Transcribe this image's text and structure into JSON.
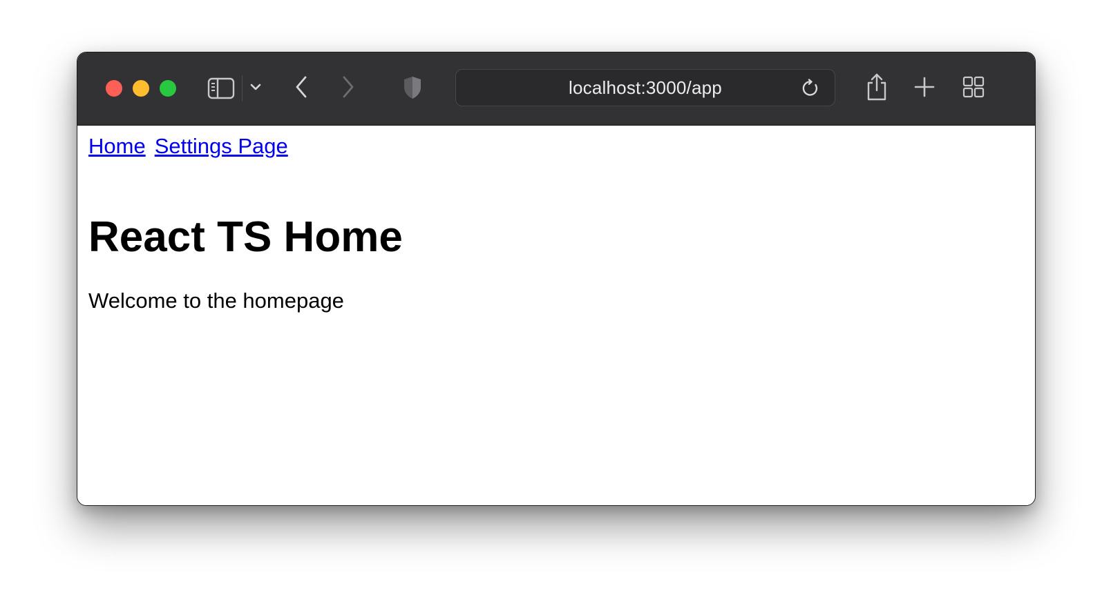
{
  "browser": {
    "address": "localhost:3000/app",
    "colors": {
      "toolbar": "#323235",
      "close": "#ff5f57",
      "minimize": "#febc2e",
      "maximize": "#28c840"
    },
    "icons": [
      "sidebar-icon",
      "chevron-down-icon",
      "back-icon",
      "forward-icon",
      "privacy-shield-icon",
      "reload-icon",
      "share-icon",
      "new-tab-icon",
      "tab-overview-icon"
    ]
  },
  "page": {
    "nav": {
      "home": "Home",
      "settings": "Settings Page"
    },
    "title": "React TS Home",
    "text": "Welcome to the homepage",
    "link_color": "#0000ee"
  }
}
